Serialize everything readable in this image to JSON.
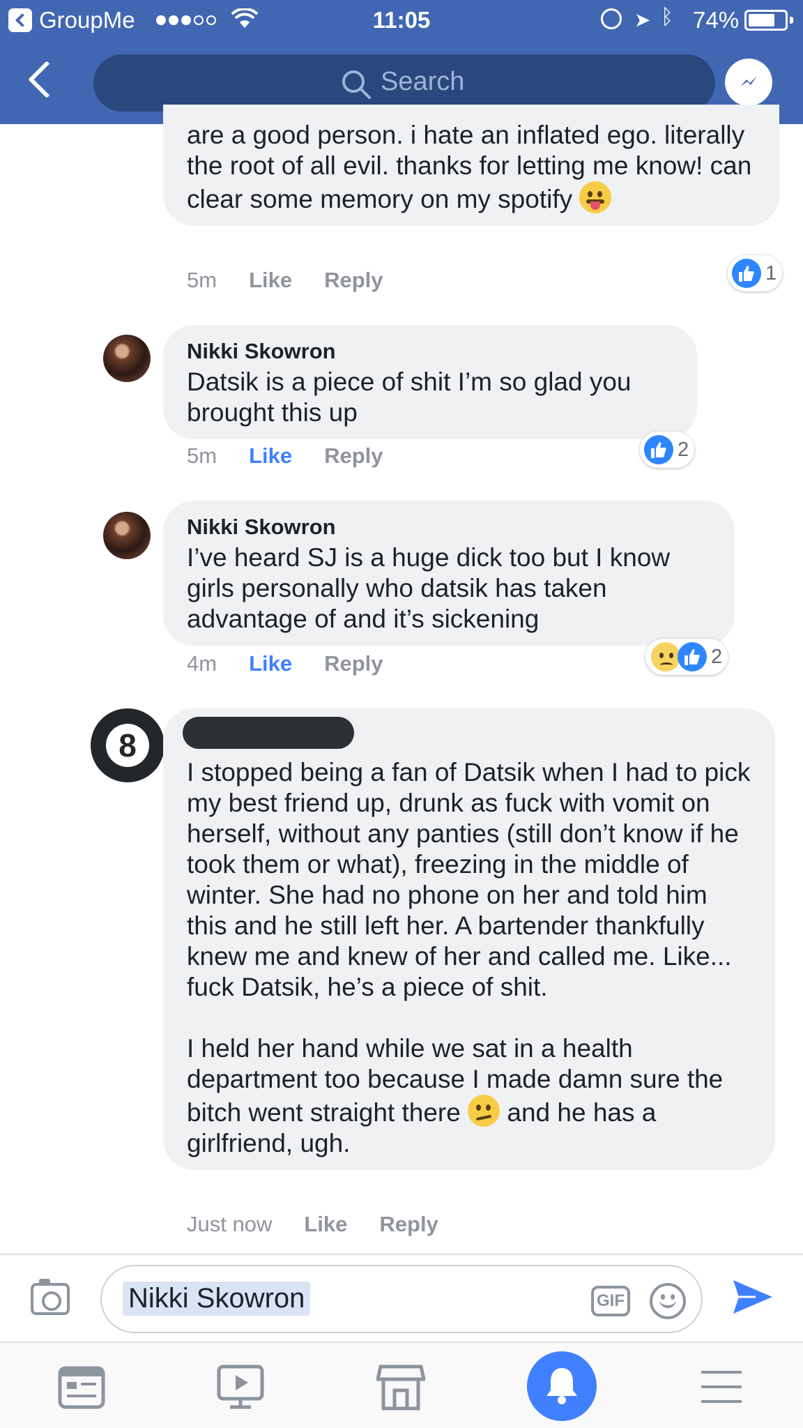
{
  "status_bar": {
    "app_name": "GroupMe",
    "time": "11:05",
    "battery": "74%",
    "battery_level": 0.74
  },
  "header": {
    "search_placeholder": "Search"
  },
  "comments": [
    {
      "author": "",
      "text": "are a good person. i hate an inflated ego. literally the root of all evil. thanks for letting me know! can clear some memory on my spotify ",
      "emoji": "face-with-tongue",
      "time": "5m",
      "like": "Like",
      "reply": "Reply",
      "liked": false,
      "reaction_count": "1"
    },
    {
      "author": "Nikki Skowron",
      "text": "Datsik is a piece of shit I’m so glad you brought this up",
      "time": "5m",
      "like": "Like",
      "reply": "Reply",
      "liked": true,
      "reaction_count": "2"
    },
    {
      "author": "Nikki Skowron",
      "text": "I’ve heard SJ is a huge dick too but I know girls personally who datsik has taken advantage of and it’s sickening",
      "time": "4m",
      "like": "Like",
      "reply": "Reply",
      "liked": true,
      "reaction_count": "2"
    },
    {
      "author": "",
      "avatar_text": "8",
      "paragraph1": "I stopped being a fan of Datsik when I had to pick my best friend up, drunk as fuck with vomit on herself, without any panties (still don’t know if he took them or what), freezing in the middle of winter. She had no phone on her and told him this and he still left her. A bartender thankfully knew me and knew of her and called me. Like... fuck Datsik, he’s a piece of shit.",
      "paragraph2_start": "I held her hand while we sat in a health department too because I made damn sure the bitch went straight there ",
      "emoji": "confused-face",
      "paragraph2_end": " and he has a girlfriend, ugh.",
      "time": "Just now",
      "like": "Like",
      "reply": "Reply",
      "liked": false
    }
  ],
  "composer": {
    "value": "Nikki Skowron",
    "gif_label": "GIF"
  },
  "tabs": [
    "news-feed",
    "watch",
    "marketplace",
    "notifications",
    "menu"
  ],
  "colors": {
    "brand": "#4267b2",
    "accent": "#4080ff",
    "bubble": "#f0f1f3"
  }
}
